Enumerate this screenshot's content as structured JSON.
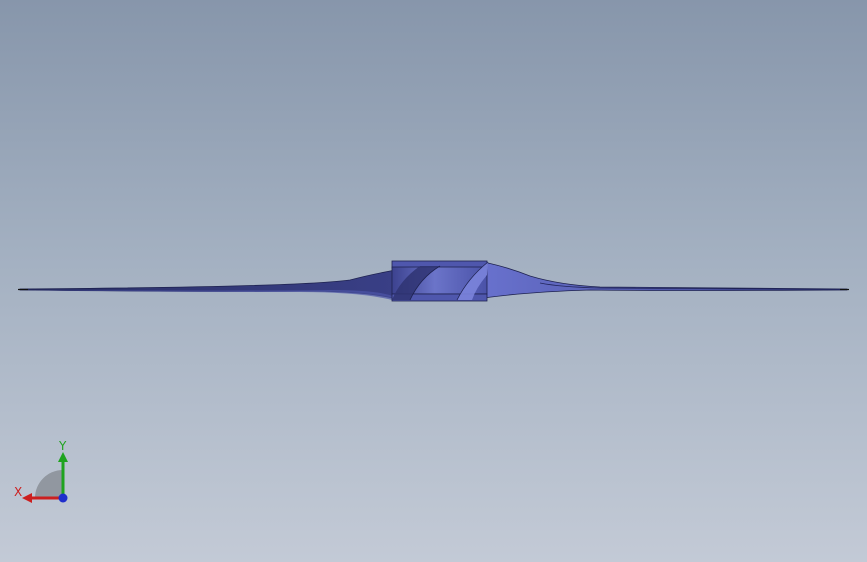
{
  "viewport": {
    "background_top": "#8796ab",
    "background_bottom": "#c3cad6"
  },
  "model": {
    "name": "propeller",
    "blade_color": "#5a63b8",
    "blade_shadow": "#2f3472",
    "hub_color": "#6a73c8"
  },
  "triad": {
    "x_label": "X",
    "y_label": "Y",
    "x_color": "#cc1f1f",
    "y_color": "#1fa31f",
    "z_color": "#1f2ecc"
  }
}
